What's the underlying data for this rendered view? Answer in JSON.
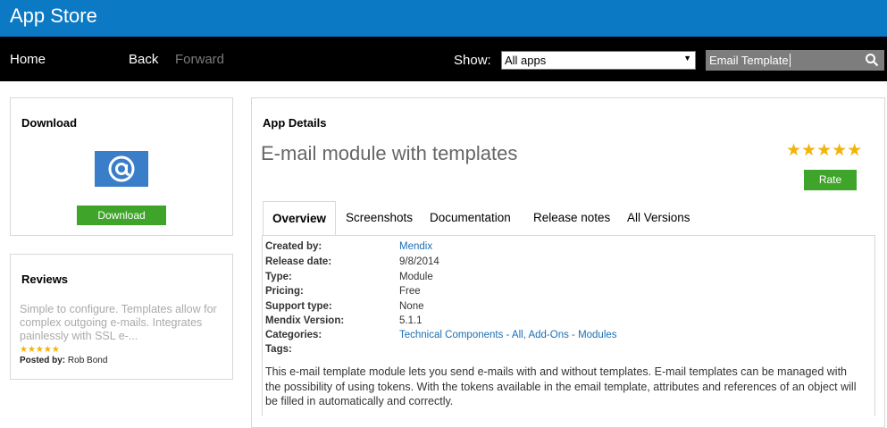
{
  "app": {
    "title": "App Store"
  },
  "nav": {
    "home": "Home",
    "back": "Back",
    "forward": "Forward",
    "show_label": "Show:",
    "show_selected": "All apps",
    "search_value": "Email Template"
  },
  "download_panel": {
    "heading": "Download",
    "button_label": "Download",
    "logo_icon": "at-sign-icon"
  },
  "reviews_panel": {
    "heading": "Reviews",
    "review_text": "Simple to configure.  Templates allow for complex outgoing e-mails. Integrates painlessly with SSL e-...",
    "rating": 5,
    "posted_by_label": "Posted by:",
    "posted_by_name": "Rob Bond"
  },
  "details": {
    "heading": "App Details",
    "app_name": "E-mail module with templates",
    "rating": 5,
    "rate_label": "Rate",
    "tabs": [
      "Overview",
      "Screenshots",
      "Documentation",
      "Release notes",
      "All Versions"
    ],
    "fields": [
      {
        "label": "Created by:",
        "value": "Mendix",
        "link": true
      },
      {
        "label": "Release date:",
        "value": "9/8/2014",
        "link": false
      },
      {
        "label": "Type:",
        "value": "Module",
        "link": false
      },
      {
        "label": "Pricing:",
        "value": "Free",
        "link": false
      },
      {
        "label": "Support type:",
        "value": "None",
        "link": false
      },
      {
        "label": "Mendix Version:",
        "value": "5.1.1",
        "link": false
      },
      {
        "label": "Categories:",
        "value": "Technical Components - All, Add-Ons - Modules",
        "link": true
      },
      {
        "label": "Tags:",
        "value": "",
        "link": false
      }
    ],
    "description": "This e-mail template module lets you send e-mails with and without templates. E-mail templates can be managed with the possibility of using tokens. With the tokens available in the email template, attributes and references of an object will be filled in automatically and correctly."
  },
  "colors": {
    "titlebar": "#0b79c4",
    "navbar": "#000000",
    "accent_green": "#3fa52a",
    "link": "#1a6fb5",
    "star": "#f2b30a"
  }
}
